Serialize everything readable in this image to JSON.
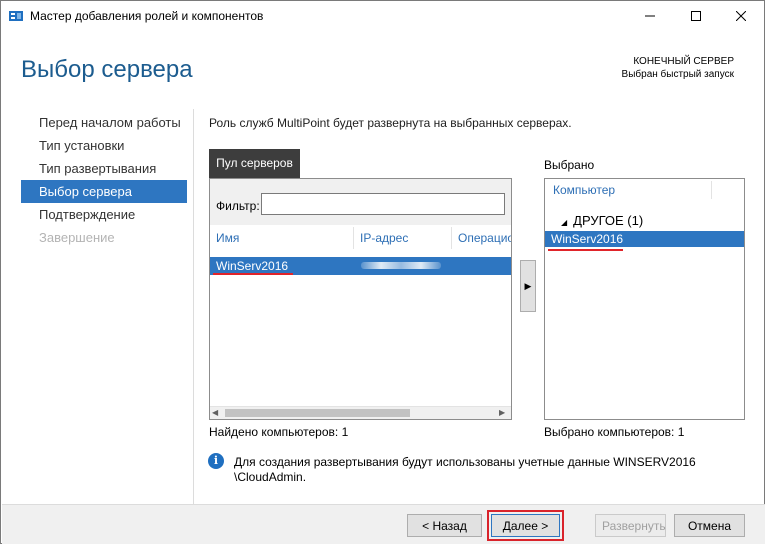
{
  "window": {
    "title": "Мастер добавления ролей и компонентов"
  },
  "header": {
    "page_title": "Выбор сервера",
    "destination_title": "КОНЕЧНЫЙ СЕРВЕР",
    "destination_sub": "Выбран быстрый запуск"
  },
  "nav": {
    "items": [
      {
        "label": "Перед началом работы"
      },
      {
        "label": "Тип установки"
      },
      {
        "label": "Тип развертывания"
      },
      {
        "label": "Выбор сервера"
      },
      {
        "label": "Подтверждение"
      },
      {
        "label": "Завершение"
      }
    ]
  },
  "main": {
    "description": "Роль служб MultiPoint будет развернута на выбранных серверах.",
    "pool_tab": "Пул серверов",
    "filter_label": "Фильтр:",
    "filter_value": "",
    "columns": [
      "Имя",
      "IP-адрес",
      "Операционная система"
    ],
    "servers": [
      {
        "name": "WinServ2016",
        "ip": ""
      }
    ],
    "found_text": "Найдено компьютеров: 1",
    "move_button": "▶",
    "selected_label": "Выбрано",
    "selected_header": "Компьютер",
    "group_label": "ДРУГОЕ (1)",
    "selected_items": [
      {
        "name": "WinServ2016"
      }
    ],
    "selected_count": "Выбрано компьютеров: 1",
    "info_text": "Для создания развертывания будут использованы учетные данные WINSERV2016 \\CloudAdmin."
  },
  "footer": {
    "back": "< Назад",
    "next": "Далее >",
    "deploy": "Развернуть",
    "cancel": "Отмена"
  },
  "colors": {
    "accent": "#2e76c1",
    "title_blue": "#1c5c8f",
    "highlight_red": "#d9232b"
  }
}
